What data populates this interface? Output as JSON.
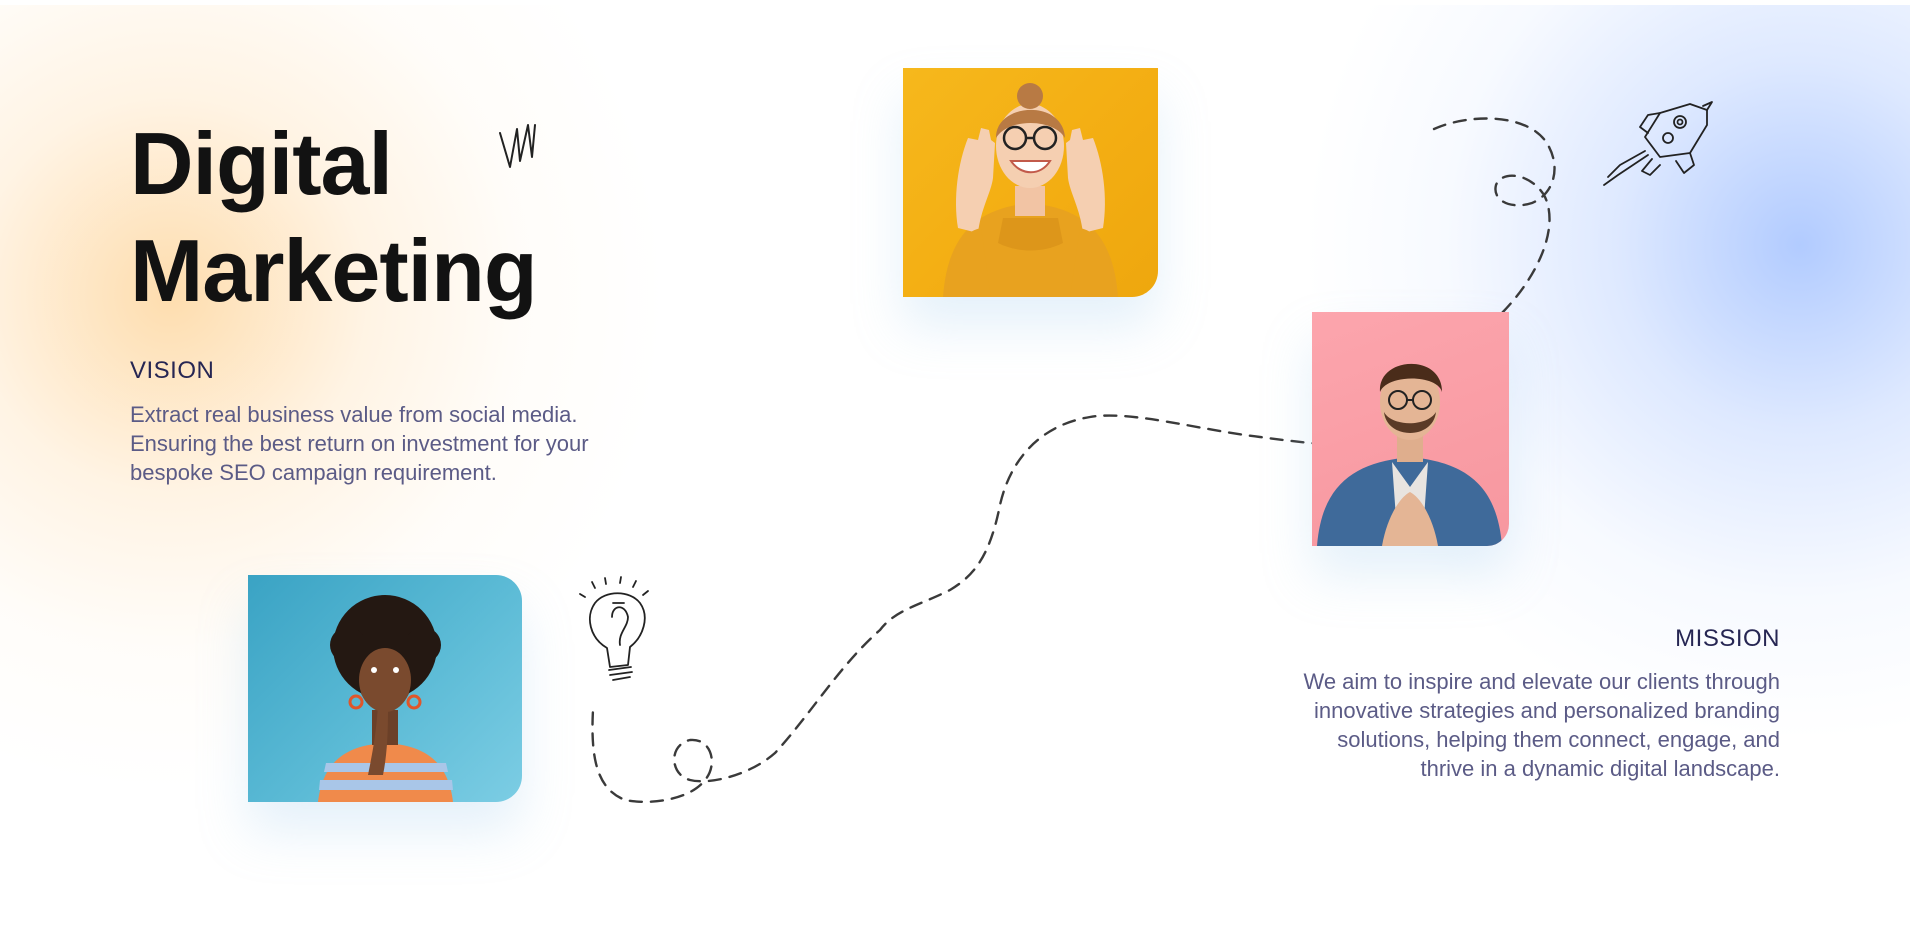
{
  "hero": {
    "title_line_1": "Digital",
    "title_line_2": "Marketing"
  },
  "vision": {
    "heading": "VISION",
    "lines": [
      "Extract real business value from social media.",
      "Ensuring the best return on investment for your",
      "bespoke SEO campaign requirement."
    ]
  },
  "mission": {
    "heading": "MISSION",
    "lines": [
      "We aim to inspire and elevate our clients through",
      "innovative strategies and personalized branding",
      "solutions, helping them connect, engage, and",
      "thrive in a dynamic digital landscape."
    ]
  },
  "colors": {
    "title": "#121212",
    "heading": "#262653",
    "body_text": "#5b5b86",
    "warm_glow": "#fed7a0",
    "cool_glow": "#a4c2ff",
    "yellow_card": "#f6b81c",
    "pink_card": "#fca5ad",
    "blue_card": "#3aa3c4",
    "dashed_path": "#3a3a3a"
  },
  "icons": [
    "scribble-icon",
    "rocket-icon",
    "lightbulb-icon",
    "dashed-path"
  ]
}
